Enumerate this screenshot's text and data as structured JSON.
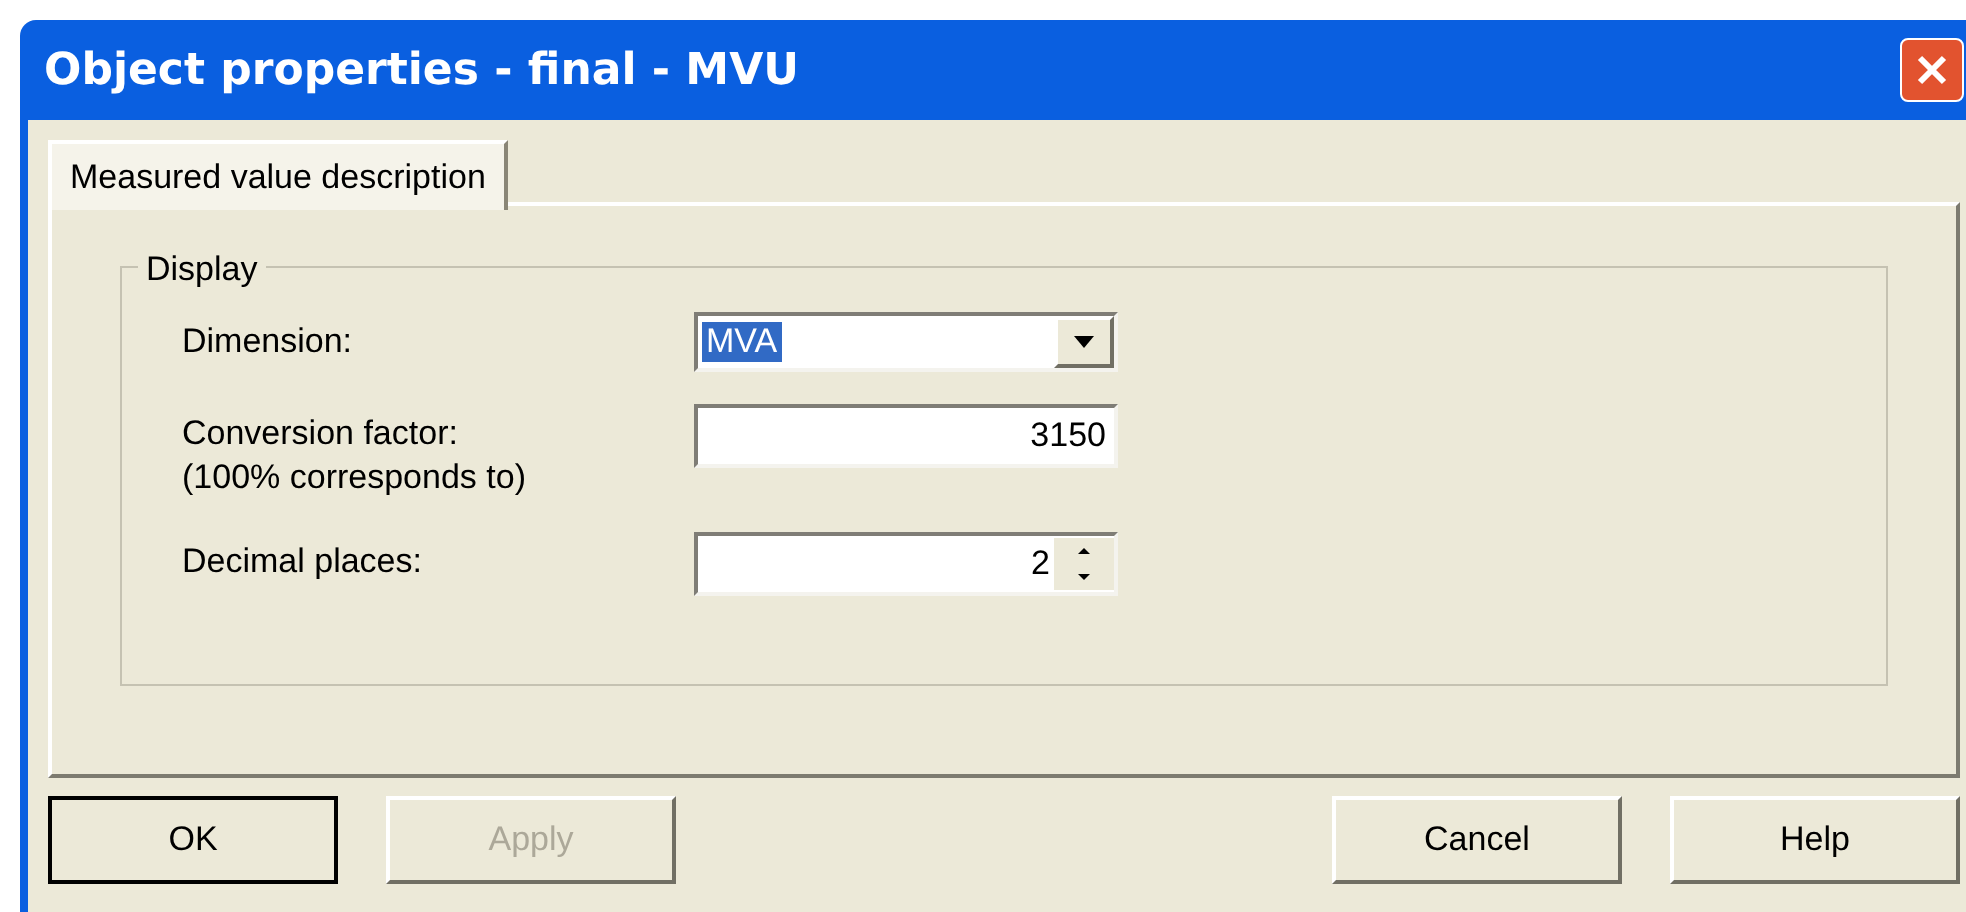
{
  "window": {
    "title": "Object properties - final - MVU"
  },
  "tabs": [
    {
      "label": "Measured value description",
      "selected": true
    }
  ],
  "group": {
    "title": "Display",
    "fields": [
      {
        "kind": "dropdown",
        "label": "Dimension:",
        "value": "MVA",
        "highlighted": true
      },
      {
        "kind": "text",
        "label": "Conversion factor:\n(100% corresponds to)",
        "value": "3150"
      },
      {
        "kind": "spinner",
        "label": "Decimal places:",
        "value": "2"
      }
    ]
  },
  "buttons": [
    {
      "label": "OK",
      "default": true,
      "disabled": false
    },
    {
      "label": "Apply",
      "default": false,
      "disabled": true
    },
    {
      "label": "Cancel",
      "default": false,
      "disabled": false
    },
    {
      "label": "Help",
      "default": false,
      "disabled": false
    }
  ]
}
